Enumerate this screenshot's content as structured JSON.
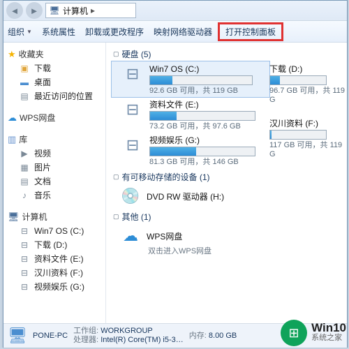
{
  "breadcrumb": {
    "root": "计算机",
    "sep": "▸"
  },
  "toolbar": {
    "organize": "组织",
    "system_props": "系统属性",
    "uninstall": "卸载或更改程序",
    "map_drive": "映射网络驱动器",
    "open_cp": "打开控制面板"
  },
  "sidebar": {
    "favorites": "收藏夹",
    "fav_items": [
      "下载",
      "桌面",
      "最近访问的位置"
    ],
    "wps": "WPS网盘",
    "libraries": "库",
    "lib_items": [
      "视频",
      "图片",
      "文档",
      "音乐"
    ],
    "computer": "计算机",
    "pc_items": [
      "Win7 OS (C:)",
      "下载 (D:)",
      "资料文件 (E:)",
      "汉川资料 (F:)",
      "视频娱乐 (G:)"
    ]
  },
  "content": {
    "hdd_hdr": "硬盘 (5)",
    "removable_hdr": "有可移动存储的设备 (1)",
    "other_hdr": "其他 (1)",
    "drives_left": [
      {
        "name": "Win7 OS (C:)",
        "usage": "92.6 GB 可用，共 119 GB",
        "fill_pct": 22
      },
      {
        "name": "资料文件 (E:)",
        "usage": "73.2 GB 可用，共 97.6 GB",
        "fill_pct": 25
      },
      {
        "name": "视频娱乐 (G:)",
        "usage": "81.3 GB 可用，共 146 GB",
        "fill_pct": 44
      }
    ],
    "drives_right": [
      {
        "name": "下载 (D:)",
        "usage": "96.7 GB 可用，共 119 G",
        "fill_pct": 18
      },
      {
        "name": "汉川资料 (F:)",
        "usage": "117 GB 可用，共 119 G",
        "fill_pct": 2
      }
    ],
    "dvd": "DVD RW 驱动器 (H:)",
    "wps_name": "WPS网盘",
    "wps_sub": "双击进入WPS网盘"
  },
  "status": {
    "name": "PONE-PC",
    "workgroup_lbl": "工作组:",
    "workgroup": "WORKGROUP",
    "mem_lbl": "内存:",
    "mem": "8.00 GB",
    "cpu_lbl": "处理器:",
    "cpu": "Intel(R) Core(TM) i5-3…"
  },
  "watermark": {
    "big": "Win10",
    "small": "系统之家"
  }
}
